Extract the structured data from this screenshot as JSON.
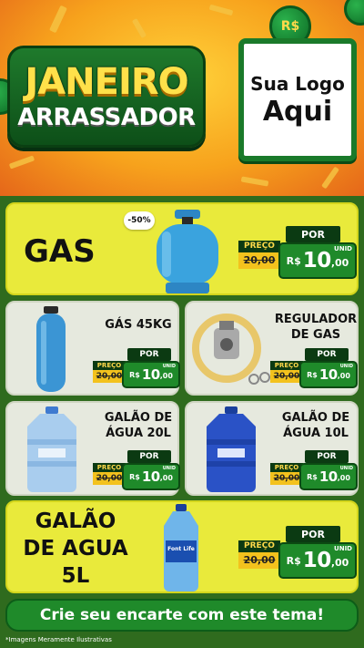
{
  "header": {
    "title_line1": "JANEIRO",
    "title_line2": "ARRASSADOR",
    "logo_line1": "Sua Logo",
    "logo_line2": "Aqui",
    "coin_symbol": "R$"
  },
  "products": [
    {
      "name": "GAS",
      "discount": "-50%",
      "por_label": "POR",
      "preco_label": "PREÇO",
      "old_price": "20,00",
      "currency": "R$",
      "price_int": "10",
      "price_cents": ",00",
      "unit": "UNID"
    },
    {
      "name": "GÁS 45KG",
      "por_label": "POR",
      "preco_label": "PREÇO",
      "old_price": "20,00",
      "currency": "R$",
      "price_int": "10",
      "price_cents": ",00",
      "unit": "UNID"
    },
    {
      "name": "REGULADOR DE GAS",
      "por_label": "POR",
      "preco_label": "PREÇO",
      "old_price": "20,00",
      "currency": "R$",
      "price_int": "10",
      "price_cents": ",00",
      "unit": "UNID"
    },
    {
      "name": "GALÃO DE ÁGUA 20L",
      "por_label": "POR",
      "preco_label": "PREÇO",
      "old_price": "20,00",
      "currency": "R$",
      "price_int": "10",
      "price_cents": ",00",
      "unit": "UNID"
    },
    {
      "name": "GALÃO DE ÁGUA 10L",
      "por_label": "POR",
      "preco_label": "PREÇO",
      "old_price": "20,00",
      "currency": "R$",
      "price_int": "10",
      "price_cents": ",00",
      "unit": "UNID"
    },
    {
      "name_line1": "GALÃO",
      "name_line2": "DE AGUA",
      "name_line3": "5L",
      "bottle_brand": "Font Life",
      "por_label": "POR",
      "preco_label": "PREÇO",
      "old_price": "20,00",
      "currency": "R$",
      "price_int": "10",
      "price_cents": ",00",
      "unit": "UNID"
    }
  ],
  "cta": "Crie seu encarte com este tema!",
  "footnote": "*Imagens Meramente Ilustrativas",
  "colors": {
    "green": "#1f8a2a",
    "dark_green": "#0b3a12",
    "yellow": "#e9ea3b",
    "orange": "#f7a21c"
  }
}
